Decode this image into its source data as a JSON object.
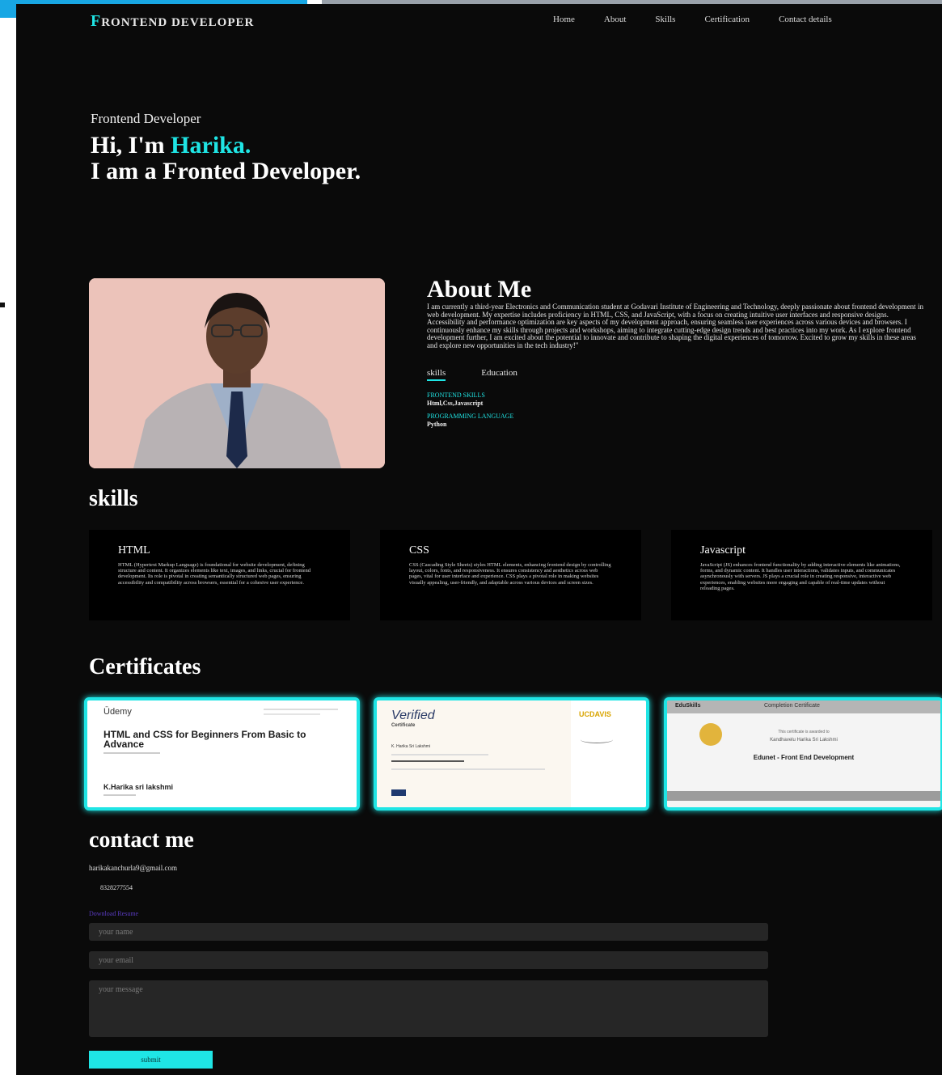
{
  "header": {
    "brand_first": "F",
    "brand_rest": "RONTEND DEVELOPER",
    "nav": [
      "Home",
      "About",
      "Skills",
      "Certification",
      "Contact details"
    ]
  },
  "hero": {
    "subtitle": "Frontend Developer",
    "greeting": "Hi, I'm ",
    "name": "Harika.",
    "line2": "I am a Fronted Developer."
  },
  "about": {
    "title": "About Me",
    "text": "I am currently a third-year Electronics and Communication student at Godavari Institute of Engineering and Technology, deeply passionate about frontend development in web development. My expertise includes proficiency in HTML, CSS, and JavaScript, with a focus on creating intuitive user interfaces and responsive designs. Accessibility and performance optimization are key aspects of my development approach, ensuring seamless user experiences across various devices and browsers. I continuously enhance my skills through projects and workshops, aiming to integrate cutting-edge design trends and best practices into my work. As I explore frontend development further, I am excited about the potential to innovate and contribute to shaping the digital experiences of tomorrow. Excited to grow my skills in these areas and explore new opportunities in the tech industry!\"",
    "tabs": [
      "skills",
      "Education"
    ],
    "skills": [
      {
        "label": "FRONTEND SKILLS",
        "value": "Html,Css,Javascript"
      },
      {
        "label": "PROGRAMMING LANGUAGE",
        "value": "Python"
      }
    ]
  },
  "skills": {
    "title": "skills",
    "cards": [
      {
        "title": "HTML",
        "text": "HTML (Hypertext Markup Language) is foundational for website development, defining structure and content. It organizes elements like text, images, and links, crucial for frontend development. Its role is pivotal in creating semantically structured web pages, ensuring accessibility and compatibility across browsers, essential for a cohesive user experience."
      },
      {
        "title": "CSS",
        "text": "CSS (Cascading Style Sheets) styles HTML elements, enhancing frontend design by controlling layout, colors, fonts, and responsiveness. It ensures consistency and aesthetics across web pages, vital for user interface and experience. CSS plays a pivotal role in making websites visually appealing, user-friendly, and adaptable across various devices and screen sizes."
      },
      {
        "title": "Javascript",
        "text": "JavaScript (JS) enhances frontend functionality by adding interactive elements like animations, forms, and dynamic content. It handles user interactions, validates inputs, and communicates asynchronously with servers. JS plays a crucial role in creating responsive, interactive web experiences, enabling websites more engaging and capable of real-time updates without reloading pages."
      }
    ]
  },
  "certificates": {
    "title": "Certificates",
    "udemy": {
      "logo": "Ūdemy",
      "course": "HTML and CSS for Beginners From Basic to Advance",
      "name": "K.Harika sri lakshmi"
    },
    "verified": {
      "badge": "Verified",
      "subtitle": "Certificate",
      "name": "K. Harika Sri Lakshmi",
      "org": "UCDAVIS"
    },
    "eduskills": {
      "brand": "EduSkills",
      "header": "Completion Certificate",
      "intro": "This certificate is awarded to",
      "name": "Kandhavelu Harika Sri Lakshmi",
      "course": "Edunet - Front End Development"
    }
  },
  "contact": {
    "title": "contact me",
    "email": "harikakanchurla9@gmail.com",
    "phone": "8328277554",
    "download": "Download Resume",
    "name_placeholder": "your name",
    "email_placeholder": "your email",
    "message_placeholder": "your message",
    "submit": "submit"
  },
  "colors": {
    "accent": "#1fe5e5",
    "background": "#0a0a0a",
    "top_bar": "#18a7e4"
  }
}
